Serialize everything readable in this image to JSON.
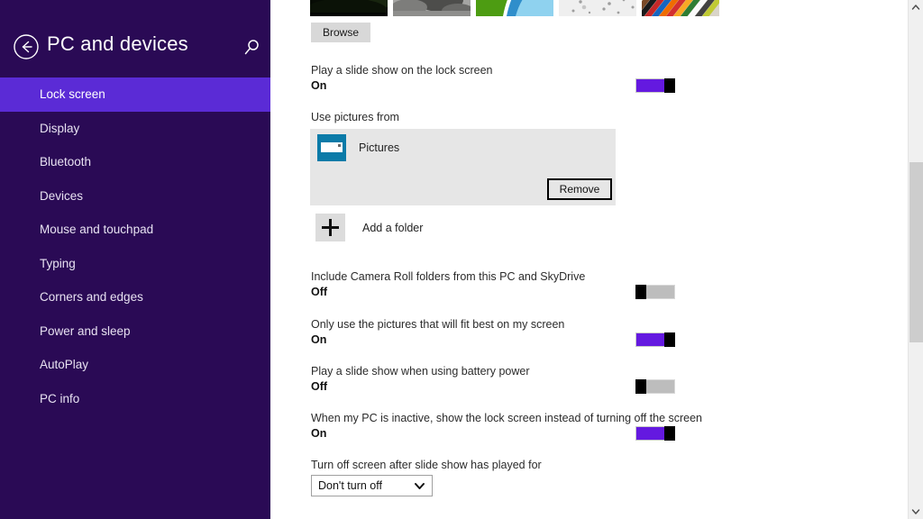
{
  "window": {
    "title": "PC and devices",
    "back_icon": "back-arrow-icon",
    "search_icon": "search-icon"
  },
  "sidebar": {
    "items": [
      {
        "label": "Lock screen",
        "selected": true
      },
      {
        "label": "Display",
        "selected": false
      },
      {
        "label": "Bluetooth",
        "selected": false
      },
      {
        "label": "Devices",
        "selected": false
      },
      {
        "label": "Mouse and touchpad",
        "selected": false
      },
      {
        "label": "Typing",
        "selected": false
      },
      {
        "label": "Corners and edges",
        "selected": false
      },
      {
        "label": "Power and sleep",
        "selected": false
      },
      {
        "label": "AutoPlay",
        "selected": false
      },
      {
        "label": "PC info",
        "selected": false
      }
    ],
    "accent_color": "#5b2bd6",
    "background_color": "#2a0a55"
  },
  "main": {
    "browse_button": "Browse",
    "thumbnails": [
      {
        "name": "dark-landscape-thumbnail",
        "colors": [
          "#0a0f07",
          "#141c0d",
          "#060806"
        ]
      },
      {
        "name": "gray-gravel-thumbnail",
        "colors": [
          "#9a9a98",
          "#6d6d6b",
          "#c0c0be"
        ]
      },
      {
        "name": "green-blue-curve-thumbnail",
        "colors": [
          "#5aa617",
          "#2f8ecb",
          "#bfe4f5"
        ]
      },
      {
        "name": "white-speckle-thumbnail",
        "colors": [
          "#e6e6e6",
          "#b8b8b8",
          "#f4f4f4"
        ]
      },
      {
        "name": "color-stripes-thumbnail",
        "colors": [
          "#d12b2b",
          "#e8a31c",
          "#1b5fa8"
        ]
      }
    ],
    "settings": [
      {
        "label": "Play a slide show on the lock screen",
        "state": "On",
        "on": true
      },
      {
        "label": "Include Camera Roll folders from this PC and SkyDrive",
        "state": "Off",
        "on": false
      },
      {
        "label": "Only use the pictures that will fit best on my screen",
        "state": "On",
        "on": true
      },
      {
        "label": "Play a slide show when using battery power",
        "state": "Off",
        "on": false
      },
      {
        "label": "When my PC is inactive, show the lock screen instead of turning off the screen",
        "state": "On",
        "on": true
      }
    ],
    "use_pictures_label": "Use pictures from",
    "picture_source": {
      "name": "Pictures",
      "icon": "pictures-folder-icon",
      "remove_button": "Remove"
    },
    "add_folder": {
      "label": "Add a folder",
      "icon": "plus-icon"
    },
    "timeout": {
      "label": "Turn off screen after slide show has played for",
      "value": "Don't turn off",
      "chevron_icon": "chevron-down-icon"
    }
  },
  "scrollbar": {
    "up_icon": "chevron-up-icon",
    "down_icon": "chevron-down-icon"
  }
}
